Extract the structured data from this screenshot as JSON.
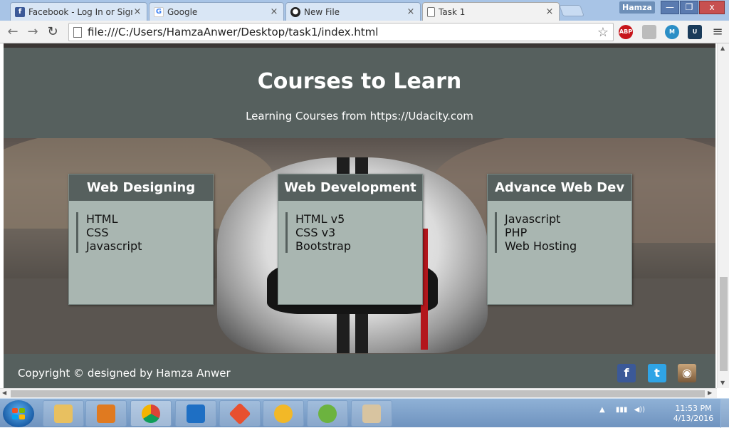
{
  "browser": {
    "tabs": [
      {
        "label": "Facebook - Log In or Sign",
        "icon": "facebook-icon",
        "color": "#3b5998"
      },
      {
        "label": "Google",
        "icon": "google-icon",
        "color": "#4285f4"
      },
      {
        "label": "New File",
        "icon": "github-icon",
        "color": "#222222"
      },
      {
        "label": "Task 1",
        "icon": "page-icon",
        "color": "#ffffff"
      }
    ],
    "user": "Hamza",
    "url": "file:///C:/Users/HamzaAnwer/Desktop/task1/index.html",
    "extensions": [
      "ABP",
      "shield",
      "M",
      "U"
    ]
  },
  "page": {
    "title": "Courses to Learn",
    "subtitle": "Learning Courses from https://Udacity.com",
    "cards": [
      {
        "title": "Web Designing",
        "items": [
          "HTML",
          "CSS",
          "Javascript"
        ]
      },
      {
        "title": "Web Development",
        "items": [
          "HTML v5",
          "CSS v3",
          "Bootstrap"
        ]
      },
      {
        "title": "Advance Web Dev",
        "items": [
          "Javascript",
          "PHP",
          "Web Hosting"
        ]
      }
    ],
    "footer": {
      "copyright": "Copyright © designed by Hamza Anwer",
      "social": [
        {
          "name": "facebook-icon",
          "glyph": "f",
          "color": "#3b5998"
        },
        {
          "name": "twitter-icon",
          "glyph": "t",
          "color": "#2fa4e6"
        },
        {
          "name": "instagram-icon",
          "glyph": "◉",
          "color": "#8a6a4a"
        }
      ]
    }
  },
  "taskbar": {
    "time": "11:53 PM",
    "date": "4/13/2016"
  }
}
